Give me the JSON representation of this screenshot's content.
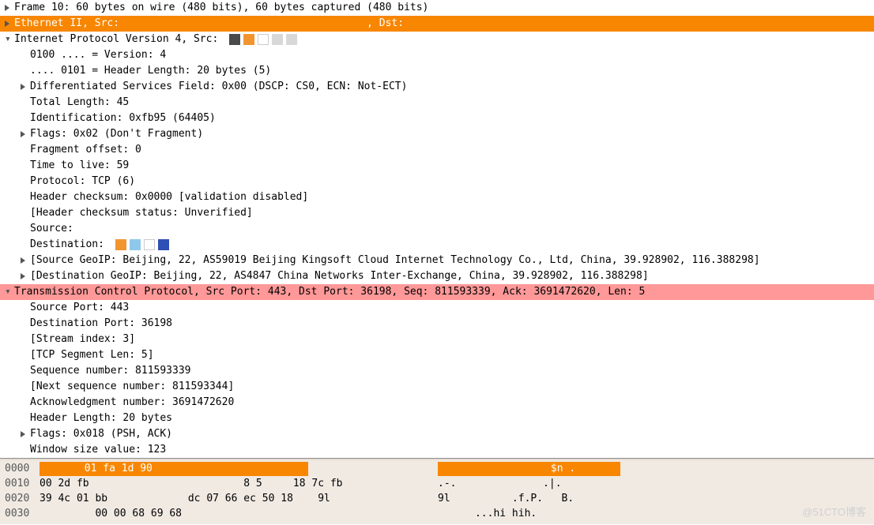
{
  "tree": {
    "frame": {
      "label": "Frame 10: 60 bytes on wire (480 bits), 60 bytes captured (480 bits)"
    },
    "eth": {
      "label": "Ethernet II, Src:                                        , Dst:"
    },
    "ip": {
      "label": "Internet Protocol Version 4, Src:",
      "children": {
        "version": "0100 .... = Version: 4",
        "hlen": ".... 0101 = Header Length: 20 bytes (5)",
        "dsf": "Differentiated Services Field: 0x00 (DSCP: CS0, ECN: Not-ECT)",
        "totlen": "Total Length: 45",
        "ident": "Identification: 0xfb95 (64405)",
        "flags": "Flags: 0x02 (Don't Fragment)",
        "fragoff": "Fragment offset: 0",
        "ttl": "Time to live: 59",
        "proto": "Protocol: TCP (6)",
        "chksum": "Header checksum: 0x0000 [validation disabled]",
        "chkstat": "[Header checksum status: Unverified]",
        "src": "Source:",
        "dst": "Destination:",
        "sgeo": "[Source GeoIP: Beijing, 22, AS59019 Beijing Kingsoft Cloud Internet Technology Co., Ltd, China, 39.928902, 116.388298]",
        "dgeo": "[Destination GeoIP: Beijing, 22, AS4847 China Networks Inter-Exchange, China, 39.928902, 116.388298]"
      }
    },
    "tcp": {
      "label": "Transmission Control Protocol, Src Port: 443, Dst Port: 36198, Seq: 811593339, Ack: 3691472620, Len: 5",
      "children": {
        "sport": "Source Port: 443",
        "dport": "Destination Port: 36198",
        "stream": "[Stream index: 3]",
        "seglen": "[TCP Segment Len: 5]",
        "seq": "Sequence number: 811593339",
        "nseq": "[Next sequence number: 811593344]",
        "ack": "Acknowledgment number: 3691472620",
        "hlen": "Header Length: 20 bytes",
        "flags": "Flags: 0x018 (PSH, ACK)",
        "win": "Window size value: 123"
      }
    }
  },
  "hex": {
    "rows": [
      {
        "off": "0000",
        "bytes_hl": "       01 fa 1d 90",
        "ascii_hl": "                  $n .       "
      },
      {
        "off": "0010",
        "bytes": "00 2d fb                         8 5     18 7c fb",
        "ascii": ".-.              .|."
      },
      {
        "off": "0020",
        "bytes": "39 4c 01 bb             dc 07 66 ec 50 18    9l",
        "ascii": "9l          .f.P.   B."
      },
      {
        "off": "0030",
        "bytes": "         00 00 68 69 68",
        "ascii": "      ...hi hih."
      }
    ]
  },
  "watermark": "@51CTO博客"
}
